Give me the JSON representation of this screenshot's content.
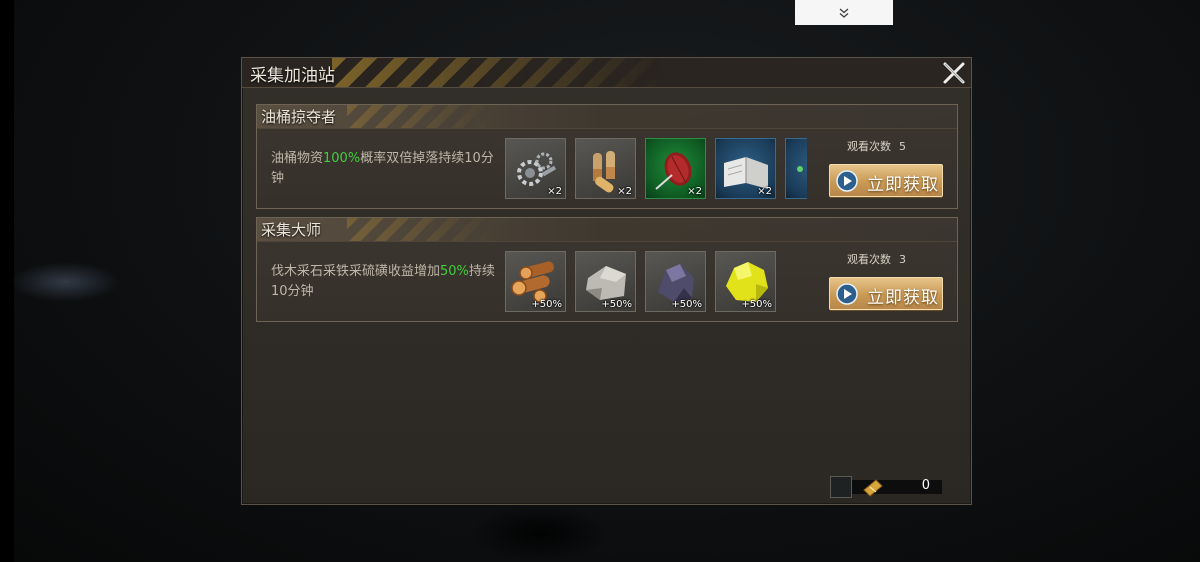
{
  "top_tab": {
    "icon": "double-chevron-down-icon"
  },
  "dialog": {
    "title": "采集加油站",
    "close_icon": "close-x-icon"
  },
  "cards": [
    {
      "title": "油桶掠夺者",
      "desc_pre": "油桶物资",
      "desc_highlight": "100%",
      "desc_post": "概率双倍掉落持续10分钟",
      "items": [
        {
          "icon": "gears-parts-icon",
          "qty": "×2"
        },
        {
          "icon": "bullets-ammo-icon",
          "qty": "×2"
        },
        {
          "icon": "thread-spool-icon",
          "qty": "×2"
        },
        {
          "icon": "open-book-icon",
          "qty": "×2"
        },
        {
          "icon": "partial-item-icon",
          "qty": ""
        }
      ],
      "views_label": "观看次数",
      "views_count": "5",
      "button_label": "立即获取"
    },
    {
      "title": "采集大师",
      "desc_pre": "伐木采石采铁采硫磺收益增加",
      "desc_highlight": "50%",
      "desc_post": "持续10分钟",
      "items": [
        {
          "icon": "wood-logs-icon",
          "qty": "+50%"
        },
        {
          "icon": "stone-icon",
          "qty": "+50%"
        },
        {
          "icon": "iron-ore-icon",
          "qty": "+50%"
        },
        {
          "icon": "sulfur-icon",
          "qty": "+50%"
        }
      ],
      "views_label": "观看次数",
      "views_count": "3",
      "button_label": "立即获取"
    }
  ],
  "currency": {
    "icon": "ticket-icon",
    "value": "0"
  },
  "colors": {
    "highlight": "#3fcf3c",
    "button": "#d2a562",
    "panel": "#2f2b26"
  }
}
